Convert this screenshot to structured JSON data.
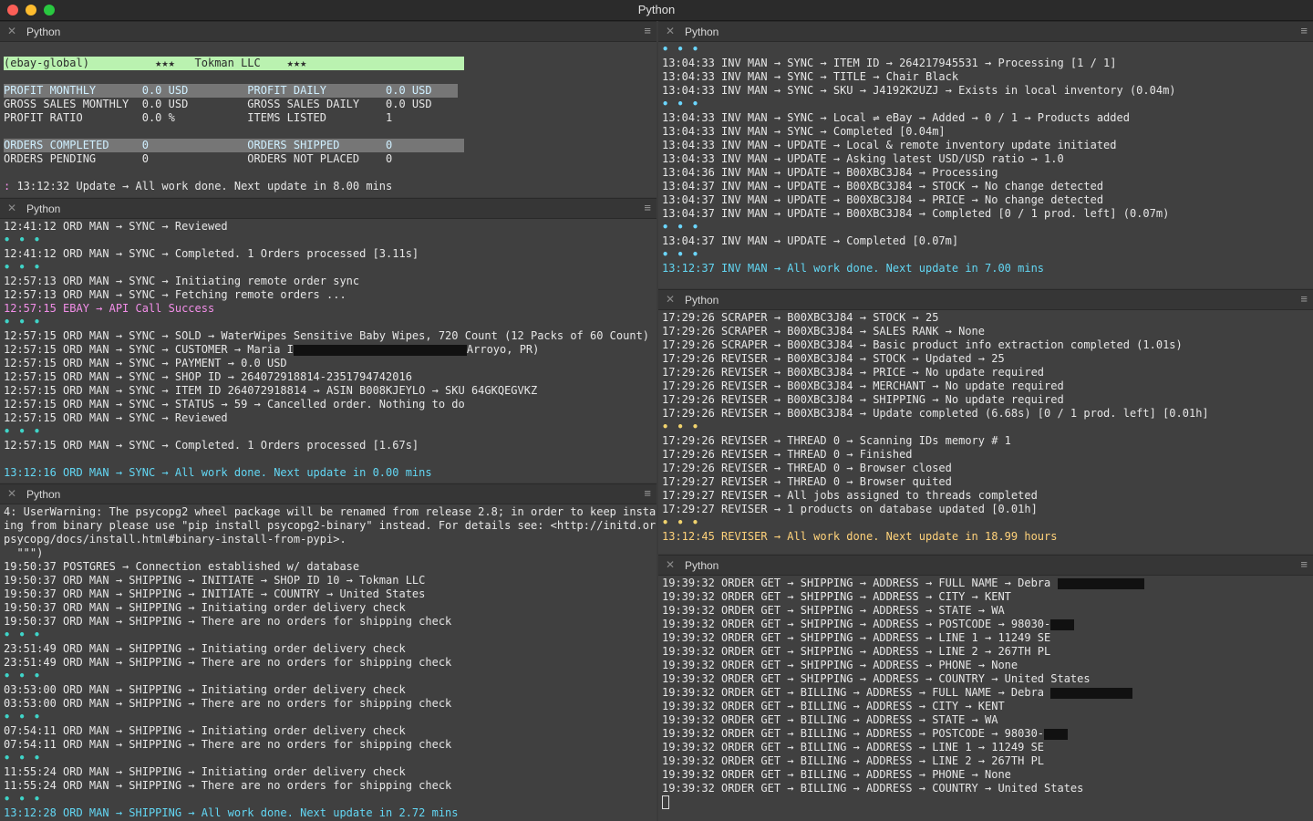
{
  "window": {
    "title": "Python"
  },
  "panes": {
    "p1": {
      "title": "Python",
      "banner": "(ebay-global)          ★★★   Tokman LLC    ★★★",
      "profit_monthly": "PROFIT MONTHLY       0.0 USD         PROFIT DAILY         0.0 USD",
      "gross_sales": "GROSS SALES MONTHLY  0.0 USD         GROSS SALES DAILY    0.0 USD",
      "profit_ratio": "PROFIT RATIO         0.0 %           ITEMS LISTED         1",
      "orders_completed": "ORDERS COMPLETED     0               ORDERS SHIPPED       0",
      "orders_pending": "ORDERS PENDING       0               ORDERS NOT PLACED    0",
      "status_line": "13:12:32 Update → All work done. Next update in 8.00 mins"
    },
    "p2": {
      "title": "Python",
      "lines": [
        "12:41:12 ORD MAN → SYNC → Reviewed",
        "12:41:12 ORD MAN → SYNC → Completed. 1 Orders processed [3.11s]",
        "12:57:13 ORD MAN → SYNC → Initiating remote order sync",
        "12:57:13 ORD MAN → SYNC → Fetching remote orders ...",
        "12:57:15 EBAY → API Call Success",
        "12:57:15 ORD MAN → SYNC → SOLD → WaterWipes Sensitive Baby Wipes, 720 Count (12 Packs of 60 Count)",
        "12:57:15 ORD MAN → SYNC → CUSTOMER → Maria I",
        "12:57:15 ORD MAN → SYNC → PAYMENT → 0.0 USD",
        "12:57:15 ORD MAN → SYNC → SHOP ID → 264072918814-2351794742016",
        "12:57:15 ORD MAN → SYNC → ITEM ID 264072918814 → ASIN B008KJEYLO → SKU 64GKQEGVKZ",
        "12:57:15 ORD MAN → SYNC → STATUS → 59 → Cancelled order. Nothing to do",
        "12:57:15 ORD MAN → SYNC → Reviewed",
        "12:57:15 ORD MAN → SYNC → Completed. 1 Orders processed [1.67s]",
        "13:12:16 ORD MAN → SYNC → All work done. Next update in 0.00 mins"
      ],
      "customer_tail": "Arroyo, PR)"
    },
    "p3": {
      "title": "Python",
      "warning1": "4: UserWarning: The psycopg2 wheel package will be renamed from release 2.8; in order to keep install",
      "warning2": "ing from binary please use \"pip install psycopg2-binary\" instead. For details see: <http://initd.org/",
      "warning3": "psycopg/docs/install.html#binary-install-from-pypi>.",
      "warning4": "  \"\"\")",
      "lines": [
        "19:50:37 POSTGRES → Connection established w/ database",
        "19:50:37 ORD MAN → SHIPPING → INITIATE → SHOP ID 10 → Tokman LLC",
        "19:50:37 ORD MAN → SHIPPING → INITIATE → COUNTRY → United States",
        "19:50:37 ORD MAN → SHIPPING → Initiating order delivery check",
        "19:50:37 ORD MAN → SHIPPING → There are no orders for shipping check",
        "23:51:49 ORD MAN → SHIPPING → Initiating order delivery check",
        "23:51:49 ORD MAN → SHIPPING → There are no orders for shipping check",
        "03:53:00 ORD MAN → SHIPPING → Initiating order delivery check",
        "03:53:00 ORD MAN → SHIPPING → There are no orders for shipping check",
        "07:54:11 ORD MAN → SHIPPING → Initiating order delivery check",
        "07:54:11 ORD MAN → SHIPPING → There are no orders for shipping check",
        "11:55:24 ORD MAN → SHIPPING → Initiating order delivery check",
        "11:55:24 ORD MAN → SHIPPING → There are no orders for shipping check",
        "13:12:28 ORD MAN → SHIPPING → All work done. Next update in 2.72 mins"
      ]
    },
    "p4": {
      "title": "Python",
      "lines": [
        "13:04:33 INV MAN → SYNC → ITEM ID → 264217945531 → Processing [1 / 1]",
        "13:04:33 INV MAN → SYNC → TITLE → Chair Black",
        "13:04:33 INV MAN → SYNC → SKU → J4192K2UZJ → Exists in local inventory (0.04m)",
        "13:04:33 INV MAN → SYNC → Local ⇌ eBay → Added → 0 / 1 → Products added",
        "13:04:33 INV MAN → SYNC → Completed [0.04m]",
        "13:04:33 INV MAN → UPDATE → Local & remote inventory update initiated",
        "13:04:33 INV MAN → UPDATE → Asking latest USD/USD ratio → 1.0",
        "13:04:36 INV MAN → UPDATE → B00XBC3J84 → Processing",
        "13:04:37 INV MAN → UPDATE → B00XBC3J84 → STOCK → No change detected",
        "13:04:37 INV MAN → UPDATE → B00XBC3J84 → PRICE → No change detected",
        "13:04:37 INV MAN → UPDATE → B00XBC3J84 → Completed [0 / 1 prod. left] (0.07m)",
        "13:04:37 INV MAN → UPDATE → Completed [0.07m]",
        "13:12:37 INV MAN → All work done. Next update in 7.00 mins"
      ]
    },
    "p5": {
      "title": "Python",
      "lines": [
        "17:29:26 SCRAPER → B00XBC3J84 → STOCK → 25",
        "17:29:26 SCRAPER → B00XBC3J84 → SALES RANK → None",
        "17:29:26 SCRAPER → B00XBC3J84 → Basic product info extraction completed (1.01s)",
        "17:29:26 REVISER → B00XBC3J84 → STOCK → Updated → 25",
        "17:29:26 REVISER → B00XBC3J84 → PRICE → No update required",
        "17:29:26 REVISER → B00XBC3J84 → MERCHANT → No update required",
        "17:29:26 REVISER → B00XBC3J84 → SHIPPING → No update required",
        "17:29:26 REVISER → B00XBC3J84 → Update completed (6.68s) [0 / 1 prod. left] [0.01h]",
        "17:29:26 REVISER → THREAD 0 → Scanning IDs memory # 1",
        "17:29:26 REVISER → THREAD 0 → Finished",
        "17:29:26 REVISER → THREAD 0 → Browser closed",
        "17:29:27 REVISER → THREAD 0 → Browser quited",
        "17:29:27 REVISER → All jobs assigned to threads completed",
        "17:29:27 REVISER → 1 products on database updated [0.01h]",
        "13:12:45 REVISER → All work done. Next update in 18.99 hours"
      ]
    },
    "p6": {
      "title": "Python",
      "lines": [
        "19:39:32 ORDER GET → SHIPPING → ADDRESS → FULL NAME → Debra",
        "19:39:32 ORDER GET → SHIPPING → ADDRESS → CITY → KENT",
        "19:39:32 ORDER GET → SHIPPING → ADDRESS → STATE → WA",
        "19:39:32 ORDER GET → SHIPPING → ADDRESS → POSTCODE → 98030-",
        "19:39:32 ORDER GET → SHIPPING → ADDRESS → LINE 1 → 11249 SE",
        "19:39:32 ORDER GET → SHIPPING → ADDRESS → LINE 2 → 267TH PL",
        "19:39:32 ORDER GET → SHIPPING → ADDRESS → PHONE → None",
        "19:39:32 ORDER GET → SHIPPING → ADDRESS → COUNTRY → United States",
        "19:39:32 ORDER GET → BILLING → ADDRESS → FULL NAME → Debra",
        "19:39:32 ORDER GET → BILLING → ADDRESS → CITY → KENT",
        "19:39:32 ORDER GET → BILLING → ADDRESS → STATE → WA",
        "19:39:32 ORDER GET → BILLING → ADDRESS → POSTCODE → 98030-",
        "19:39:32 ORDER GET → BILLING → ADDRESS → LINE 1 → 11249 SE",
        "19:39:32 ORDER GET → BILLING → ADDRESS → LINE 2 → 267TH PL",
        "19:39:32 ORDER GET → BILLING → ADDRESS → PHONE → None",
        "19:39:32 ORDER GET → BILLING → ADDRESS → COUNTRY → United States"
      ]
    }
  }
}
